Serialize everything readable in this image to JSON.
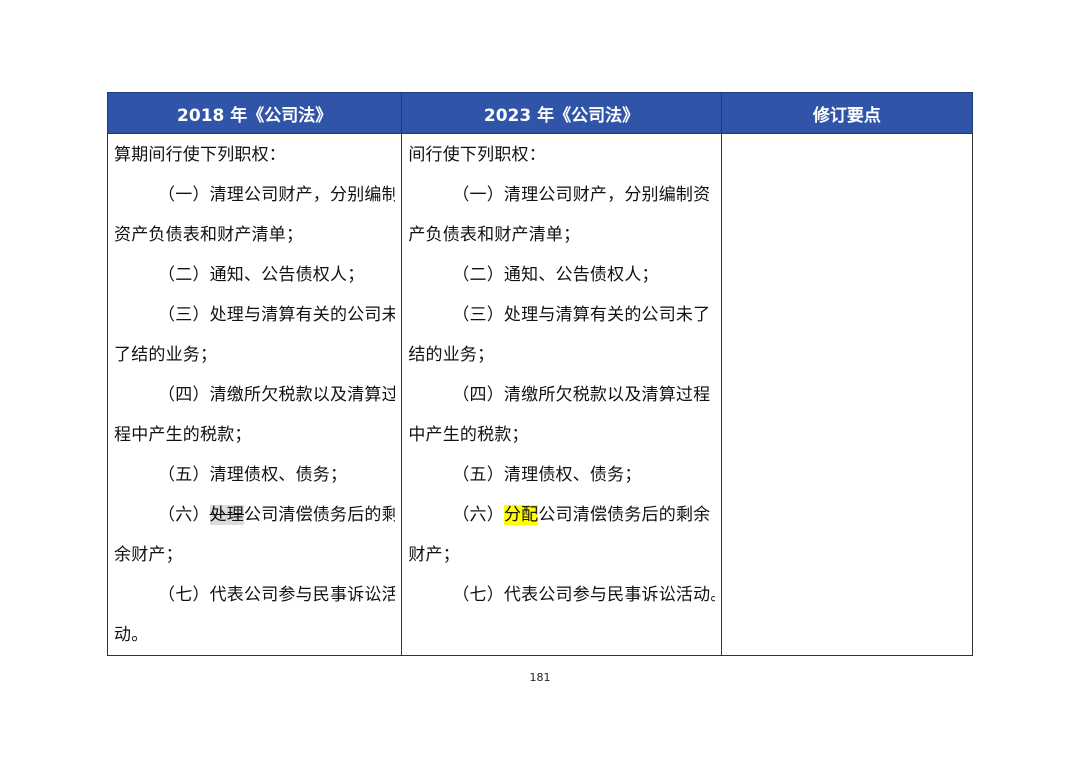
{
  "table": {
    "headers": [
      "2018 年《公司法》",
      "2023 年《公司法》",
      "修订要点"
    ],
    "col2018": {
      "l1": "算期间行使下列职权：",
      "l2": "（一）清理公司财产，分别编制",
      "l3": "资产负债表和财产清单；",
      "l4": "（二）通知、公告债权人；",
      "l5": "（三）处理与清算有关的公司未",
      "l6": "了结的业务；",
      "l7": "（四）清缴所欠税款以及清算过",
      "l8": "程中产生的税款；",
      "l9": "（五）清理债权、债务；",
      "l10_pre": "（六）",
      "l10_strike": "处理",
      "l10_post": "公司清偿债务后的剩",
      "l11": "余财产；",
      "l12": "（七）代表公司参与民事诉讼活",
      "l13": "动。"
    },
    "col2023": {
      "l1": "间行使下列职权：",
      "l2": "（一）清理公司财产，分别编制资",
      "l3": "产负债表和财产清单；",
      "l4": "（二）通知、公告债权人；",
      "l5": "（三）处理与清算有关的公司未了",
      "l6": "结的业务；",
      "l7": "（四）清缴所欠税款以及清算过程",
      "l8": "中产生的税款；",
      "l9": "（五）清理债权、债务；",
      "l10_pre": "（六）",
      "l10_hl": "分配",
      "l10_post": "公司清偿债务后的剩余",
      "l11": "财产；",
      "l12": "（七）代表公司参与民事诉讼活动。"
    },
    "col_notes": ""
  },
  "page_number": "181",
  "colors": {
    "header_bg": "#2f54a8",
    "header_text": "#ffffff",
    "strike_bg": "#dcdcdc",
    "highlight": "#ffff00"
  }
}
